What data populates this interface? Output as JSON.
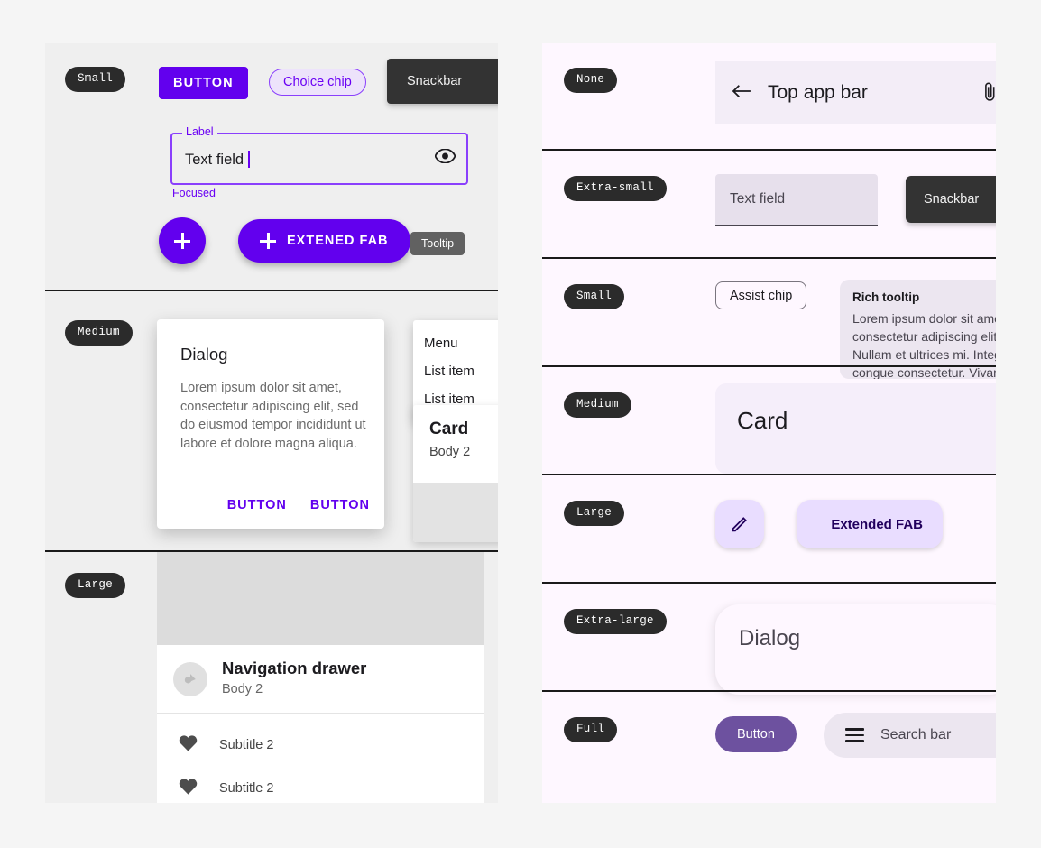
{
  "left_panel": {
    "sections": [
      {
        "token_label": "Small",
        "button_label": "BUTTON",
        "chip_label": "Choice chip",
        "snackbar_label": "Snackbar",
        "text_field": {
          "label": "Label",
          "value": "Text field",
          "helper": "Focused",
          "trailing_icon": "eye-icon"
        },
        "fab_icon": "plus-icon",
        "extended_fab_label": "EXTENED FAB",
        "tooltip_label": "Tooltip"
      },
      {
        "token_label": "Medium",
        "dialog": {
          "title": "Dialog",
          "body": "Lorem ipsum dolor sit amet, consectetur adipiscing elit, sed do eiusmod tempor incididunt ut labore et dolore magna aliqua.",
          "action_1": "BUTTON",
          "action_2": "BUTTON"
        },
        "menu": {
          "header": "Menu",
          "items": [
            "List item",
            "List item"
          ]
        },
        "card": {
          "title": "Card",
          "body": "Body 2"
        }
      },
      {
        "token_label": "Large",
        "nav_drawer": {
          "title": "Navigation drawer",
          "subtitle": "Body 2",
          "avatar_icon": "avatar-placeholder-icon",
          "rows": [
            {
              "icon": "heart-icon",
              "label": "Subtitle 2"
            },
            {
              "icon": "heart-icon",
              "label": "Subtitle 2"
            }
          ]
        }
      }
    ]
  },
  "right_panel": {
    "rows": [
      {
        "token_label": "None",
        "top_app_bar": {
          "back_icon": "arrow-back-icon",
          "title": "Top app bar",
          "action_icon": "attachment-icon"
        }
      },
      {
        "token_label": "Extra-small",
        "text_field_placeholder": "Text field",
        "snackbar_label": "Snackbar"
      },
      {
        "token_label": "Small",
        "assist_chip_label": "Assist chip",
        "rich_tooltip": {
          "title": "Rich tooltip",
          "body": "Lorem ipsum dolor sit amet, consectetur adipiscing elit. Nullam et ultrices mi. Integer congue consectetur. Vivamus."
        }
      },
      {
        "token_label": "Medium",
        "card_title": "Card"
      },
      {
        "token_label": "Large",
        "fab_icon": "pencil-icon",
        "extended_fab_label": "Extended FAB"
      },
      {
        "token_label": "Extra-large",
        "dialog_title": "Dialog"
      },
      {
        "token_label": "Full",
        "button_label": "Button",
        "search_bar": {
          "menu_icon": "hamburger-icon",
          "placeholder": "Search bar"
        }
      }
    ]
  },
  "colors": {
    "primary": "#6200ee",
    "chip_border": "#8a3ffc",
    "token_pill_bg": "#2b2b2b",
    "left_panel_bg": "#efefef",
    "right_panel_bg": "#fef7ff",
    "fab_tonal_bg": "#e9ddff",
    "fab_tonal_fg": "#21005d",
    "snackbar_bg": "#333333",
    "tooltip_bg": "#616161",
    "page_bg": "#f5f5f5"
  }
}
